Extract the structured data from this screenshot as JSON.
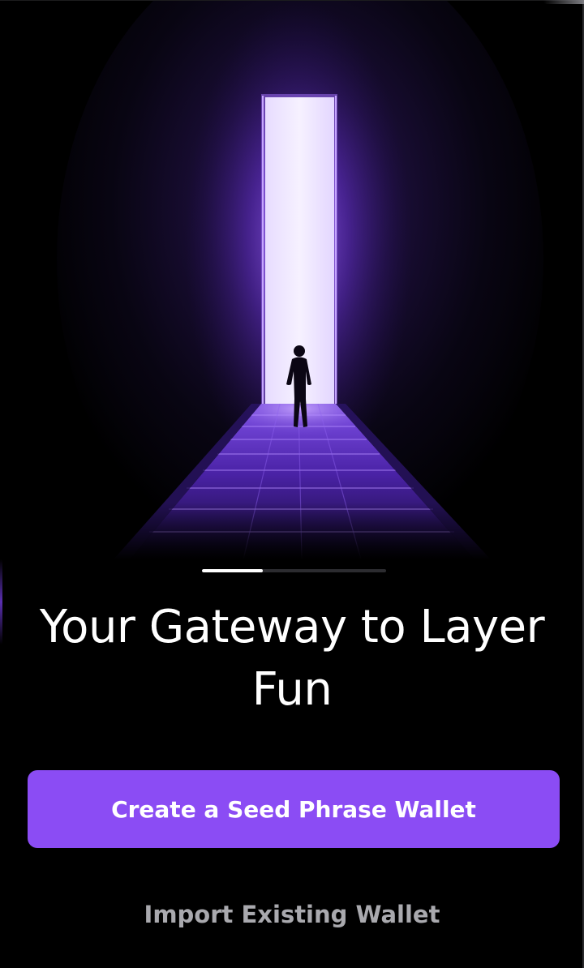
{
  "onboarding": {
    "headline": "Your Gateway to Layer Fun",
    "carousel": {
      "current_slide_fraction": 0.33
    },
    "primary_action": {
      "label": "Create a Seed Phrase Wallet"
    },
    "secondary_action": {
      "label": "Import Existing Wallet"
    },
    "hero_image": {
      "icon": "hero-illustration-person-walking-toward-light-doorway"
    }
  },
  "colors": {
    "background": "#000000",
    "accent": "#8b4cf4",
    "headline_text": "#ffffff",
    "secondary_text": "#a9a9ae",
    "progress_track": "#2c2c30",
    "progress_fill": "#ffffff"
  }
}
